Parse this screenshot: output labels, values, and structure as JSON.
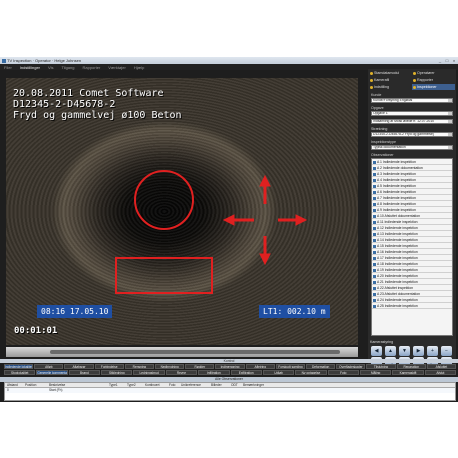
{
  "window": {
    "title": "TV Inspection · Operator · Helge Johnsen",
    "controls": [
      "_",
      "□",
      "×"
    ]
  },
  "menu": {
    "items": [
      "Filer",
      "Indstillinger",
      "Vis",
      "Tilgang",
      "Rapporter",
      "Værktøjer",
      "Hjælp"
    ],
    "active_index": 1
  },
  "video": {
    "osd_lines": [
      "20.08.2011  Comet Software",
      "D12345-2-D45678-2",
      "Fryd og gammelvej ø100 Beton"
    ],
    "time_box": "08:16  17.05.10",
    "distance_box": "LT1:    002.10 m",
    "counter": "00:01:01",
    "overlay_colors": {
      "circle": "#e02020",
      "rect": "#e02020",
      "arrows": "#e02020",
      "osd_box": "#1f4fa3"
    }
  },
  "right_panel": {
    "tabs": [
      {
        "label": "Stamdatamodul",
        "active": false
      },
      {
        "label": "Operatører",
        "active": false
      },
      {
        "label": "Kamerafil",
        "active": false
      },
      {
        "label": "Rapporter",
        "active": false
      },
      {
        "label": "Indstilling",
        "active": false
      },
      {
        "label": "Inspektioner",
        "active": true
      }
    ],
    "fields": [
      {
        "label": "Kunde",
        "value": "Kunde/Forsyning Engødal"
      },
      {
        "label": "Opgave",
        "value": "Opgave 1"
      },
      {
        "label": "Indsamling af Mosk øllede fr. 12.07.2010",
        "value": "Indsamling af Mosk øllede fr. 12.07.2010"
      },
      {
        "label": "Strækning",
        "value": "D12345-2-D45678-2 Fryd og gammelvej"
      },
      {
        "label": "Inspektionstype",
        "value": "Typisk dokumentation"
      }
    ],
    "observations_label": "Observationer",
    "observations": [
      "A 1 Indledende inspektion",
      "A 2 Indledende dokumentation",
      "A 3 Indledende inspektion",
      "A 4 Indledende inspektion",
      "A 5 Indledende inspektion",
      "A 6 Indledende inspektion",
      "A 7 Indledende inspektion",
      "A 8 Indledende inspektion",
      "A 9 Indledende inspektion",
      "A 10 Afsluttet dokumentation",
      "A 11 Indledende inspektion",
      "A 12 Indledende inspektion",
      "A 13 Indledende inspektion",
      "A 14 Indledende inspektion",
      "A 15 Indledende inspektion",
      "A 16 Indledende inspektion",
      "A 17 Indledende inspektion",
      "A 18 Indledende inspektion",
      "A 19 Indledende inspektion",
      "A 20 Indledende inspektion",
      "A 21 Indledende inspektion",
      "A 22 Afsluttet inspektion",
      "A 23 Afsluttet dokumentation",
      "A 24 Indledende inspektion",
      "A 25 Indledende inspektion"
    ]
  },
  "controls_panel": {
    "label": "Kamerastyring",
    "buttons": [
      "◀",
      "▲",
      "▼",
      "▶",
      "+",
      "−",
      "●",
      "◀",
      "▲",
      "▼",
      "▶",
      "■"
    ]
  },
  "bottom": {
    "divider_label": "Kontrol",
    "row1": [
      "Indledende lokalitet",
      "Afløb",
      "Afløbsrør",
      "Forbindelse",
      "Rensning",
      "Nedbrydning",
      "Rødder",
      "Indtrængning",
      "Aflejring",
      "Forskudt samling",
      "Deformation",
      "Overfladeskader",
      "Tilslutning",
      "Reparation",
      "Afsluttet"
    ],
    "row1_highlight": 0,
    "row2": [
      "Stoplokalitet",
      "Generelle kommentarer",
      "Brønd",
      "Stikledning",
      "Ledningsbrud",
      "Revne",
      "Infiltration",
      "Exfiltration",
      "Udløb",
      "Ny optagelse",
      "Foto",
      "Måling",
      "Kameraskift",
      "Afslut"
    ],
    "row2_highlight": 1,
    "grid_title": "Alle Observationer",
    "grid_headers": [
      "Afstand",
      "Position",
      "Beskrivelse",
      "Type1",
      "Type2",
      "Kontinuert",
      "Foto",
      "Unikreference",
      "Billeder",
      "ODT",
      "Bemærkninger"
    ],
    "grid_rows": [
      [
        "0",
        "",
        "Start (Fh)",
        "",
        "",
        "",
        "",
        "",
        "",
        "",
        ""
      ]
    ]
  }
}
